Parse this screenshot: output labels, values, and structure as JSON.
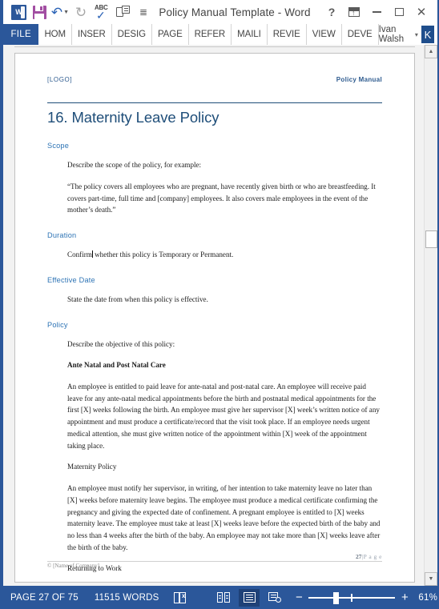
{
  "titlebar": {
    "app_title": "Policy Manual Template - Word",
    "quick_access": [
      {
        "name": "word-logo-icon",
        "label": "W"
      },
      {
        "name": "save-icon",
        "label": "Save"
      },
      {
        "name": "undo-icon",
        "label": "Undo"
      },
      {
        "name": "redo-icon",
        "label": "Repeat"
      },
      {
        "name": "spelling-grammar-icon",
        "label": "ABC"
      },
      {
        "name": "touch-mouse-mode-icon",
        "label": "Touch/Mouse Mode"
      },
      {
        "name": "customize-quick-access-toolbar-icon",
        "label": "≡"
      }
    ],
    "window_controls": {
      "help": "?",
      "ribbon_display_options": "Ribbon Display Options",
      "minimize": "Minimize",
      "maximize": "Maximize",
      "close": "✕"
    }
  },
  "ribbon": {
    "file_tab": "FILE",
    "tabs": [
      {
        "label": "HOM"
      },
      {
        "label": "INSER"
      },
      {
        "label": "DESIG"
      },
      {
        "label": "PAGE"
      },
      {
        "label": "REFER"
      },
      {
        "label": "MAILI"
      },
      {
        "label": "REVIE"
      },
      {
        "label": "VIEW"
      },
      {
        "label": "DEVE"
      }
    ],
    "account": {
      "name": "Ivan Walsh",
      "caret": "▾",
      "avatar_initial": "K"
    }
  },
  "document": {
    "header": {
      "logo": "[LOGO]",
      "right": "Policy Manual"
    },
    "title": "16. Maternity Leave Policy",
    "sections": [
      {
        "heading": "Scope",
        "paragraphs": [
          "Describe the scope of the policy, for example:",
          "“The policy covers all employees who are pregnant, have recently given birth or who are breastfeeding. It covers part-time, full time and [company] employees. It also covers male employees in the event of the mother’s death.”"
        ]
      },
      {
        "heading": "Duration",
        "paragraphs": [
          "Confirm whether this policy is Temporary or Permanent."
        ]
      },
      {
        "heading": "Effective Date",
        "paragraphs": [
          "State the date from when this policy is effective."
        ]
      },
      {
        "heading": "Policy",
        "paragraphs": [
          "Describe the objective of this policy:"
        ],
        "subsections": [
          {
            "subheading": "Ante Natal and Post Natal Care",
            "body": "An employee is entitled to paid leave for ante-natal and post-natal care. An employee will receive paid leave for any ante-natal medical appointments before the birth and postnatal medical appointments for the first [X] weeks following the birth. An employee must give her supervisor [X] week’s written notice of any appointment and must produce a certificate/record that the visit took place. If an employee needs urgent medical attention, she must give written notice of the appointment within [X] week of the appointment taking place."
          },
          {
            "subheading": "Maternity Policy",
            "body": "An employee must notify her supervisor, in writing, of her intention to take maternity leave no later than [X] weeks before maternity leave begins. The employee must produce a medical certificate confirming the pregnancy and giving the expected date of confinement. A pregnant employee is entitled to [X] weeks maternity leave. The employee must take at least [X] weeks leave before the expected birth of the baby and no less than 4 weeks after the birth of the baby. An employee may not take more than [X] weeks leave after the birth of the baby."
          },
          {
            "subheading": "Returning to Work",
            "body": ""
          }
        ]
      }
    ],
    "footer": {
      "page_number": "27",
      "page_label": "P a g e",
      "separator": "|",
      "copyright": "© [Name of Company]"
    }
  },
  "statusbar": {
    "page_status": "PAGE 27 OF 75",
    "word_count": "11515 WORDS",
    "proofing_icon": "proofing-errors-icon",
    "views": [
      {
        "name": "read-mode-view-button",
        "label": "Read Mode",
        "active": false
      },
      {
        "name": "print-layout-view-button",
        "label": "Print Layout",
        "active": true
      },
      {
        "name": "web-layout-view-button",
        "label": "Web Layout",
        "active": false
      }
    ],
    "zoom": {
      "out": "−",
      "in": "+",
      "percent": "61%"
    }
  },
  "scrollbar": {
    "up_arrow": "▲",
    "down_arrow": "▼"
  },
  "colors": {
    "word_blue": "#2b579a",
    "title_navy": "#1f4e79",
    "heading_blue": "#2e74b5"
  }
}
